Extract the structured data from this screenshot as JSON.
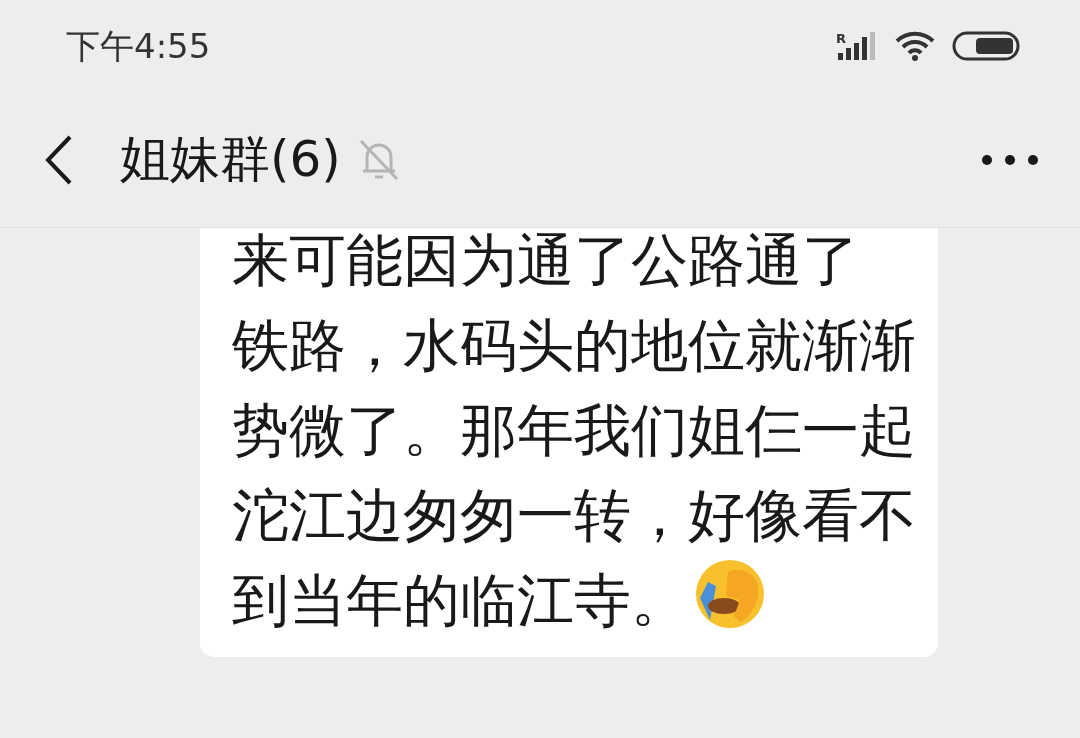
{
  "status_bar": {
    "time": "下午4:55",
    "signal_label": "R"
  },
  "header": {
    "title": "姐妹群(6)",
    "muted": true
  },
  "message": {
    "lines": [
      "来可能因为通了公路通了",
      "铁路，水码头的地位就渐渐",
      "势微了。那年我们姐仨一起",
      "沱江边匆匆一转，好像看不",
      "到当年的临江寺。"
    ],
    "ends_with_emoji": true
  }
}
